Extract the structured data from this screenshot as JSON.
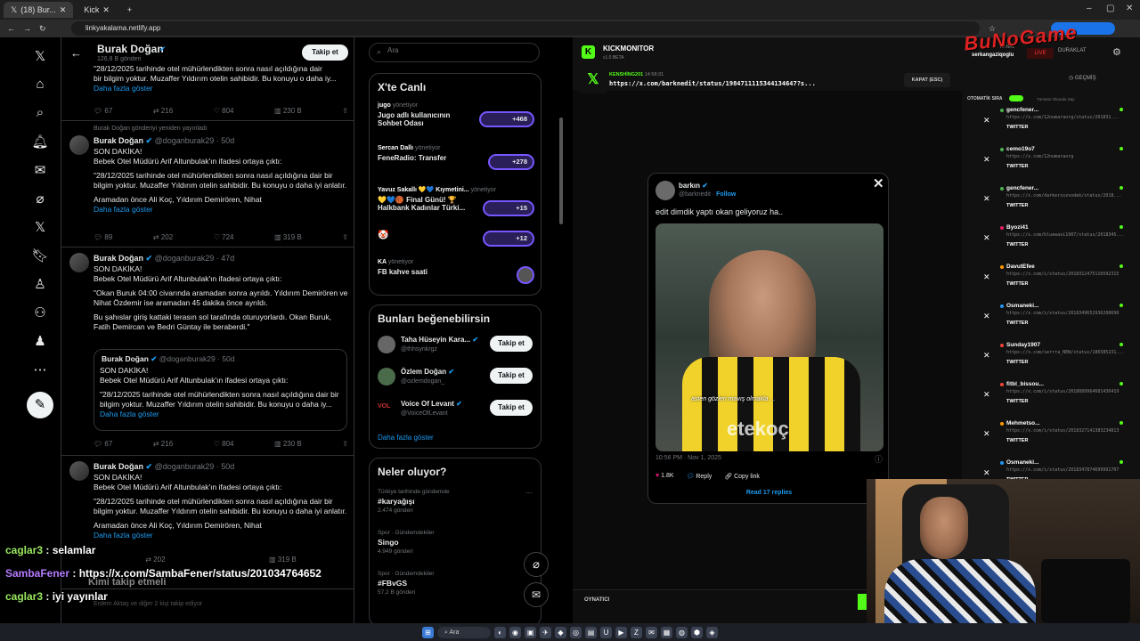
{
  "browser": {
    "tabs": [
      {
        "label": "(18) Bur..."
      },
      {
        "label": "Kick"
      }
    ],
    "url": "linkyakalama.netlify.app"
  },
  "profile_header": {
    "name": "Burak Doğan",
    "posts": "126,8 B gönderi",
    "follow_label": "Takip et"
  },
  "tweets": [
    {
      "body_lines": [
        "\"28/12/2025 tarihinde otel mühürlendikten sonra nasıl açıldığına dair",
        "bir bilgim yoktur. Muzaffer Yıldırım otelin sahibidir. Bu konuyu o daha iy..."
      ],
      "more": "Daha fazla göster",
      "actions": [
        "67",
        "216",
        "804",
        "230 B"
      ]
    },
    {
      "repost": "Burak Doğan gönderiyi yeniden yayınladı",
      "name": "Burak Doğan",
      "handle": "@doganburak29 · 50d",
      "p1": "SON DAKİKA!",
      "p2": "Bebek Otel Müdürü Arif Altunbulak'ın ifadesi ortaya çıktı:",
      "p3": "\"28/12/2025 tarihinde otel mühürlendikten sonra nasıl açıldığına dair bir bilgim yoktur. Muzaffer Yıldırım otelin sahibidir. Bu konuyu o daha iyi anlatır.",
      "p4": "Aramadan önce Ali Koç, Yıldırım Demirören, Nihat",
      "more": "Daha fazla göster",
      "actions": [
        "89",
        "202",
        "724",
        "319 B"
      ]
    },
    {
      "name": "Burak Doğan",
      "handle": "@doganburak29 · 47d",
      "p1": "SON DAKİKA!",
      "p2": "Bebek Otel Müdürü Arif Altunbulak'ın ifadesi ortaya çıktı:",
      "p3": "\"Okan Buruk 04:00 civarında aramadan sonra ayrıldı. Yıldırım Demirören ve Nihat Özdemir ise aramadan 45 dakika önce ayrıldı.",
      "p4": "Bu şahıslar giriş kattaki terasın sol tarafında oturuyorlardı. Okan Buruk, Fatih Demircan ve Bedri Güntay ile beraberdi.\"",
      "quote": {
        "name": "Burak Doğan",
        "handle": "@doganburak29 · 50d",
        "p1": "SON DAKİKA!",
        "p2": "Bebek Otel Müdürü Arif Altunbulak'ın ifadesi ortaya çıktı:",
        "p3": "\"28/12/2025 tarihinde otel mühürlendikten sonra nasıl açıldığına dair bir bilgim yoktur. Muzaffer Yıldırım otelin sahibidir. Bu konuyu o daha iy...",
        "more": "Daha fazla göster"
      },
      "actions": [
        "67",
        "216",
        "804",
        "230 B"
      ]
    },
    {
      "name": "Burak Doğan",
      "handle": "@doganburak29 · 50d",
      "p1": "SON DAKİKA!",
      "p2": "Bebek Otel Müdürü Arif Altunbulak'ın ifadesi ortaya çıktı:",
      "p3": "\"28/12/2025 tarihinde otel mühürlendikten sonra nasıl açıldığına dair bir bilgim yoktur. Muzaffer Yıldırım otelin sahibidir. Bu konuyu o daha iyi anlatır.",
      "p4": "Aramadan önce Ali Koç, Yıldırım Demirören, Nihat",
      "more": "Daha fazla göster",
      "actions": [
        "202",
        "319 B"
      ]
    }
  ],
  "bottom_feed": {
    "who_follow": "Kimi takip etmeli",
    "followers_note": "Erdem Aktaş ve diğer 2 kişi takip ediyor"
  },
  "search": {
    "placeholder": "Ara"
  },
  "spaces": {
    "title": "X'te Canlı",
    "items": [
      {
        "host": "jugo",
        "role": "yönetiyor",
        "title": "Jugo adlı kullanıcının Sohbet Odası",
        "count": "+468"
      },
      {
        "host": "Sercan Dallı",
        "role": "yönetiyor",
        "title": "FeneRadio: Transfer",
        "count": "+278"
      },
      {
        "host": "Yavuz Sakallı 💛💙 Kıymetini...",
        "role": "yönetiyor",
        "title": "💛💙🏀 Final Günü! 🏆 Halkbank Kadınlar Türki...",
        "count": "+15"
      },
      {
        "host": "",
        "role": "",
        "title": "🤡",
        "count": "+12"
      },
      {
        "host": "KA",
        "role": "yönetiyor",
        "title": "FB kahve saati",
        "count": ""
      }
    ]
  },
  "suggestions": {
    "title": "Bunları beğenebilirsin",
    "follow_label": "Takip et",
    "items": [
      {
        "name": "Taha Hüseyin Kara...",
        "handle": "@thhsynkrgz"
      },
      {
        "name": "Özlem Doğan",
        "handle": "@ozlemdogan_"
      },
      {
        "name": "Voice Of Levant",
        "handle": "@VoiceOfLevant"
      }
    ],
    "more": "Daha fazla göster"
  },
  "trends": {
    "title": "Neler oluyor?",
    "items": [
      {
        "context": "Türkiye tarihinde gündemde",
        "name": "#karyağışı",
        "count": "2.474 gönderi"
      },
      {
        "context": "Spor · Gündemdekiler",
        "name": "Singo",
        "count": "4.949 gönderi"
      },
      {
        "context": "Spor · Gündemdekiler",
        "name": "#FBvGS",
        "count": "57,2 B gönderi"
      }
    ]
  },
  "kick": {
    "brand": "KICKMONITOR",
    "version": "v1.0 BETA",
    "sender": "KENSHİNG201",
    "time": "14:58:31",
    "url": "https://x.com/barknedit/status/1984711115344134647?s...",
    "close_label": "KAPAT (ESC)",
    "channel_label": "KANAL",
    "channel": "serkangaziqoglu",
    "live": "LIVE",
    "stop": "DURAKLAT",
    "history": "GEÇMİŞ",
    "auto_label": "OTOMATİK SIRA",
    "clear_all": "Tümünü Okundu Say",
    "player": "OYNATICI",
    "list": [
      {
        "name": "gencfener...",
        "url": "https://x.com/12numaraorg/status/201831...",
        "color": "#4caf50"
      },
      {
        "name": "cemo19o7",
        "url": "https://x.com/12numaraorg",
        "color": "#4caf50"
      },
      {
        "name": "gencfener...",
        "url": "https://x.com/darkersszvodek/status/2018...",
        "color": "#4caf50"
      },
      {
        "name": "Byozi41",
        "url": "https://x.com/bluewavi1907/status/2018345...",
        "color": "#e91e63"
      },
      {
        "name": "DavutEfee",
        "url": "https://x.com/i/status/2018312475116592315",
        "color": "#ff9800"
      },
      {
        "name": "Osmaneki...",
        "url": "https://x.com/i/status/2018349652936208690",
        "color": "#2196f3"
      },
      {
        "name": "Sunday1907",
        "url": "https://x.com/serrra_NEW/status/186585231...",
        "color": "#f44336"
      },
      {
        "name": "fitbl_bissou...",
        "url": "https://x.com/i/status/2018089964681430419",
        "color": "#f44336"
      },
      {
        "name": "Mehmetso...",
        "url": "https://x.com/i/status/2018327141383234813",
        "color": "#ff9800"
      },
      {
        "name": "Osmaneki...",
        "url": "https://x.com/i/status/2018347874699991707",
        "color": "#2196f3"
      }
    ],
    "twitter_label": "TWITTER"
  },
  "embedded_tweet": {
    "name": "barkın",
    "handle": "@barknedit",
    "follow": "Follow",
    "text": "edit dimdik yaptı okan geliyoruz ha..",
    "caption": "asten gözleri mavış olmakla ...",
    "watermark": "etekoç",
    "timestamp": "10:56 PM · Nov 1, 2025",
    "likes": "1.8K",
    "reply": "Reply",
    "copy": "Copy link",
    "replies": "Read 17 replies"
  },
  "chat": [
    {
      "user": "caglar3",
      "msg": "selamlar",
      "color": "#9bea5f"
    },
    {
      "user": "SambaFener",
      "msg": "https://x.com/SambaFener/status/201034764652",
      "color": "#b57bff"
    },
    {
      "user": "caglar3",
      "msg": "iyi yayınlar",
      "color": "#9bea5f"
    }
  ],
  "overlay_logo": "BuNoGame",
  "taskbar": {
    "search": "Ara"
  }
}
